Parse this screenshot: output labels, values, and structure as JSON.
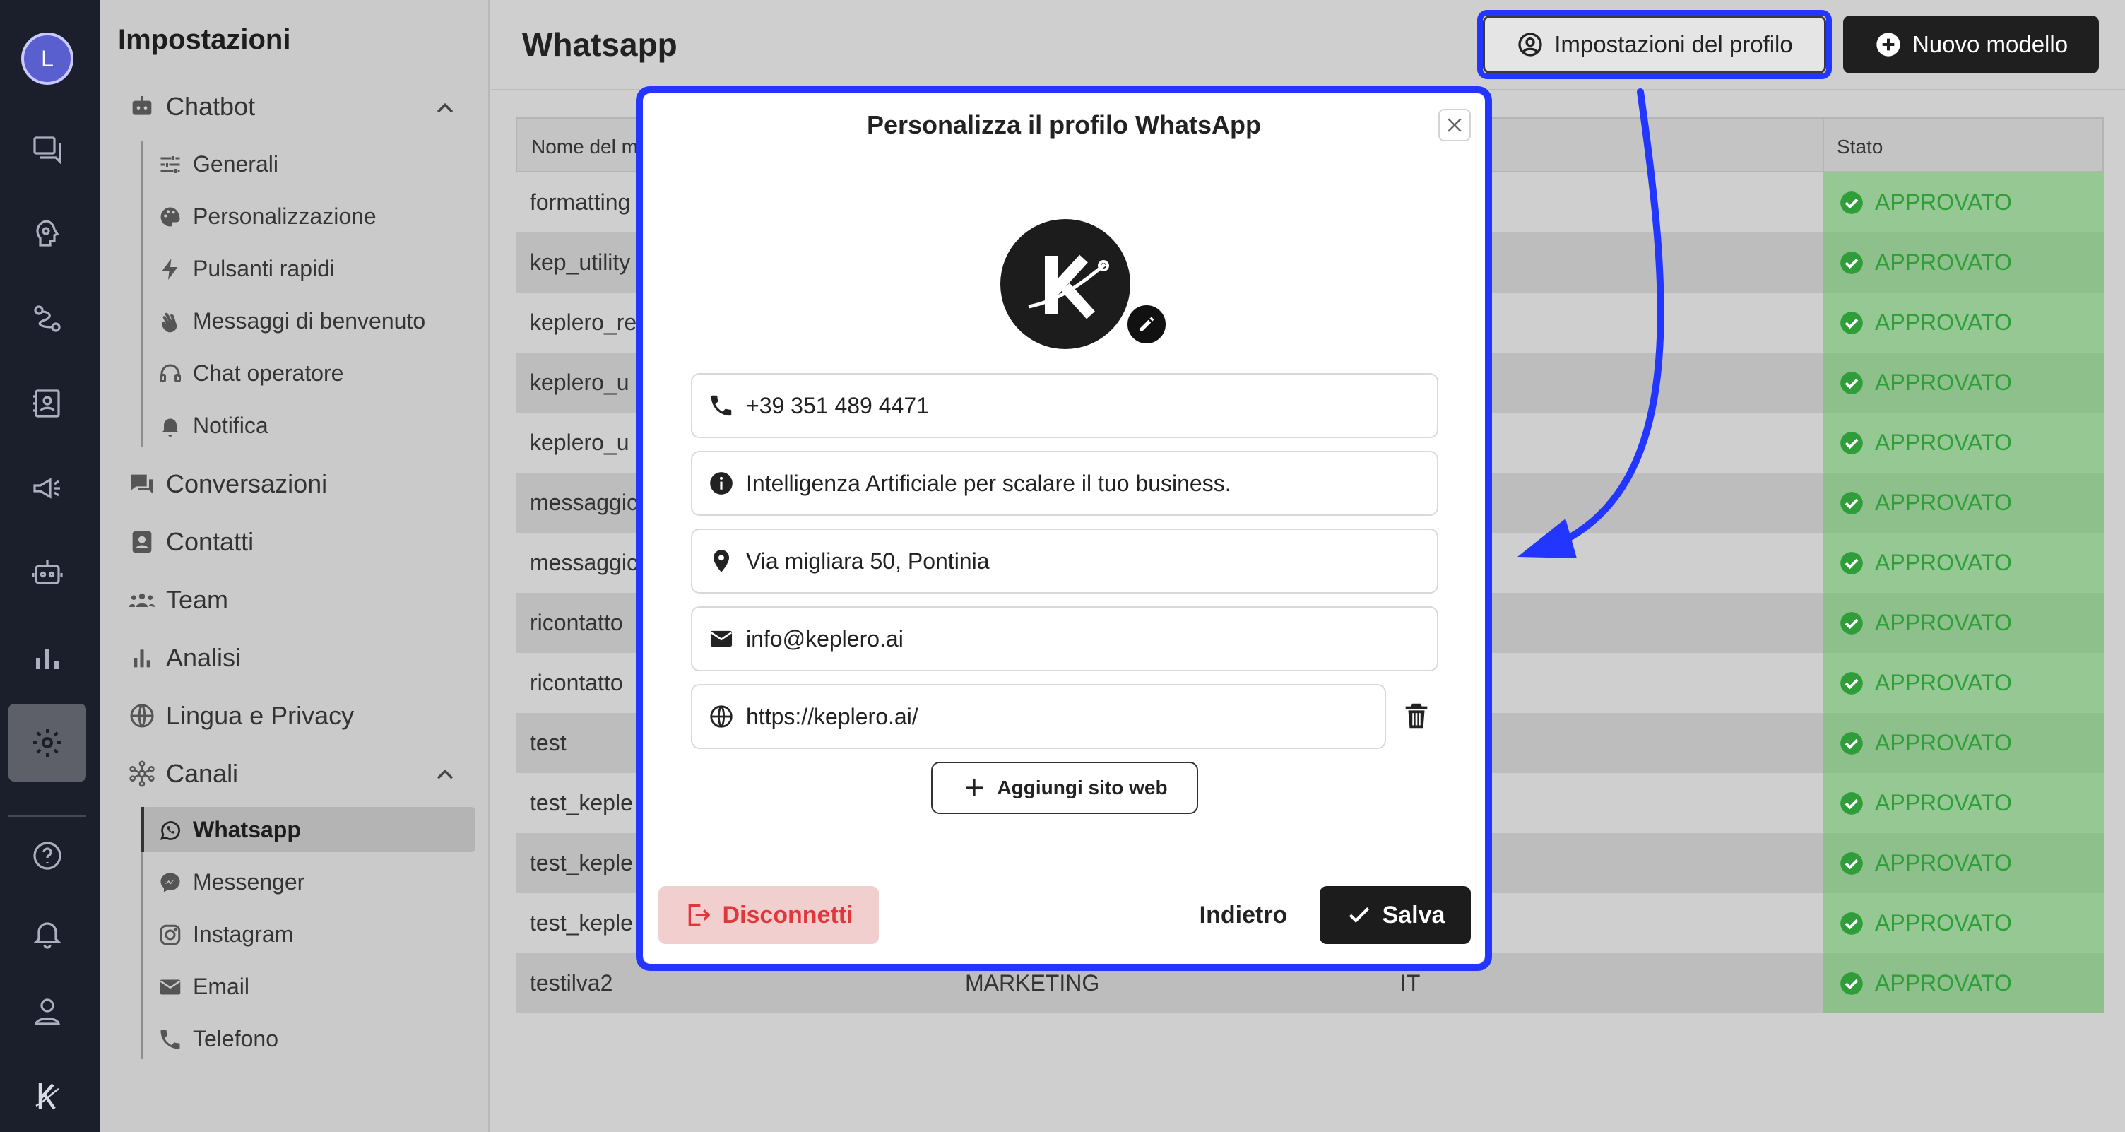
{
  "user": {
    "initial": "L"
  },
  "sidebar": {
    "title": "Impostazioni",
    "chatbot": {
      "label": "Chatbot",
      "items": [
        "Generali",
        "Personalizzazione",
        "Pulsanti rapidi",
        "Messaggi di benvenuto",
        "Chat operatore",
        "Notifica"
      ]
    },
    "sections": [
      "Conversazioni",
      "Contatti",
      "Team",
      "Analisi",
      "Lingua e Privacy"
    ],
    "canali": {
      "label": "Canali",
      "items": [
        "Whatsapp",
        "Messenger",
        "Instagram",
        "Email",
        "Telefono"
      ]
    }
  },
  "header": {
    "title": "Whatsapp",
    "profile_button": "Impostazioni del profilo",
    "new_button": "Nuovo modello"
  },
  "table": {
    "columns": [
      "Nome del m",
      "Stato"
    ],
    "rows": [
      {
        "name": "formatting",
        "category": "",
        "language": "",
        "status": "APPROVATO"
      },
      {
        "name": "kep_utility",
        "category": "",
        "language": "",
        "status": "APPROVATO"
      },
      {
        "name": "keplero_re",
        "category": "",
        "language": "",
        "status": "APPROVATO"
      },
      {
        "name": "keplero_u",
        "category": "",
        "language": "",
        "status": "APPROVATO"
      },
      {
        "name": "keplero_u",
        "category": "",
        "language": "",
        "status": "APPROVATO"
      },
      {
        "name": "messaggic",
        "category": "",
        "language": "",
        "status": "APPROVATO"
      },
      {
        "name": "messaggic",
        "category": "",
        "language": "",
        "status": "APPROVATO"
      },
      {
        "name": "ricontatto",
        "category": "",
        "language": "",
        "status": "APPROVATO"
      },
      {
        "name": "ricontatto",
        "category": "",
        "language": "",
        "status": "APPROVATO"
      },
      {
        "name": "test",
        "category": "",
        "language": "",
        "status": "APPROVATO"
      },
      {
        "name": "test_keple",
        "category": "",
        "language": "",
        "status": "APPROVATO"
      },
      {
        "name": "test_keple",
        "category": "",
        "language": "",
        "status": "APPROVATO"
      },
      {
        "name": "test_keple",
        "category": "",
        "language": "",
        "status": "APPROVATO"
      },
      {
        "name": "testilva2",
        "category": "MARKETING",
        "language": "IT",
        "status": "APPROVATO"
      }
    ]
  },
  "modal": {
    "title": "Personalizza il profilo WhatsApp",
    "phone": "+39 351 489 4471",
    "description": "Intelligenza Artificiale per scalare il tuo business.",
    "address": "Via migliara 50, Pontinia",
    "email": "info@keplero.ai",
    "website": "https://keplero.ai/",
    "add_website": "Aggiungi sito web",
    "disconnect": "Disconnetti",
    "back": "Indietro",
    "save": "Salva"
  },
  "colors": {
    "highlight": "#2236ff",
    "status_green": "#2f9e3a",
    "danger": "#e0383a"
  }
}
